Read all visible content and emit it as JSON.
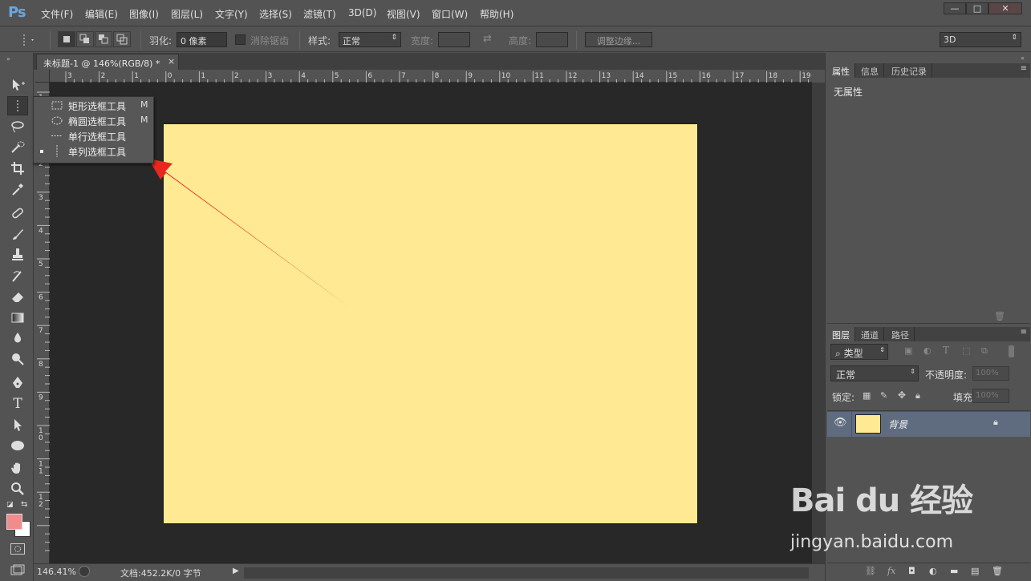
{
  "app": {
    "logo": "Ps"
  },
  "menu": {
    "items": [
      "文件(F)",
      "编辑(E)",
      "图像(I)",
      "图层(L)",
      "文字(Y)",
      "选择(S)",
      "滤镜(T)",
      "3D(D)",
      "视图(V)",
      "窗口(W)",
      "帮助(H)"
    ]
  },
  "window_controls": {
    "minimize": "—",
    "maximize": "□",
    "close": "✕"
  },
  "options": {
    "feather_label": "羽化:",
    "feather_value": "0 像素",
    "antialias_label": "消除锯齿",
    "style_label": "样式:",
    "style_value": "正常",
    "width_label": "宽度:",
    "height_label": "高度:",
    "refine_edge": "调整边缘...",
    "workspace": "3D"
  },
  "document": {
    "tab_title": "未标题-1 @ 146%(RGB/8) *",
    "tab_close": "×",
    "canvas_color": "#ffe992"
  },
  "ruler": {
    "h_labels": [
      "3",
      "2",
      "1",
      "0",
      "1",
      "2",
      "3",
      "4",
      "5",
      "6",
      "7",
      "8",
      "9",
      "10",
      "11",
      "12",
      "13",
      "14",
      "15",
      "16",
      "17",
      "18",
      "19"
    ],
    "v_labels": [
      "1",
      "1",
      "2",
      "3",
      "4",
      "5",
      "6",
      "7",
      "8",
      "9",
      "1 0",
      "1 1",
      "1 2"
    ]
  },
  "flyout": {
    "items": [
      {
        "label": "矩形选框工具",
        "key": "M",
        "icon": "rect-marquee-icon"
      },
      {
        "label": "椭圆选框工具",
        "key": "M",
        "icon": "ellipse-marquee-icon"
      },
      {
        "label": "单行选框工具",
        "key": "",
        "icon": "single-row-marquee-icon"
      },
      {
        "label": "单列选框工具",
        "key": "",
        "icon": "single-column-marquee-icon",
        "selected": true
      }
    ]
  },
  "status": {
    "zoom": "146.41%",
    "doc_info": "文档:452.2K/0 字节"
  },
  "properties_panel": {
    "tabs": [
      "属性",
      "信息",
      "历史记录"
    ],
    "active_tab": "属性",
    "content": "无属性"
  },
  "layers_panel": {
    "tabs": [
      "图层",
      "通道",
      "路径"
    ],
    "active_tab": "图层",
    "filter_kind": "类型",
    "blend_mode": "正常",
    "opacity_label": "不透明度:",
    "opacity_value": "100%",
    "lock_label": "锁定:",
    "fill_label": "填充:",
    "fill_value": "100%",
    "layers": [
      {
        "name": "背景",
        "thumb_color": "#ffe992",
        "visible": true,
        "locked": true
      }
    ]
  },
  "watermark": {
    "brand": "Bai du 经验",
    "url": "jingyan.baidu.com"
  },
  "colors": {
    "foreground": "#f08c8c",
    "background": "#ffffff",
    "annotation_arrow": "#e8281e",
    "layer_selected": "#5f6c80"
  }
}
